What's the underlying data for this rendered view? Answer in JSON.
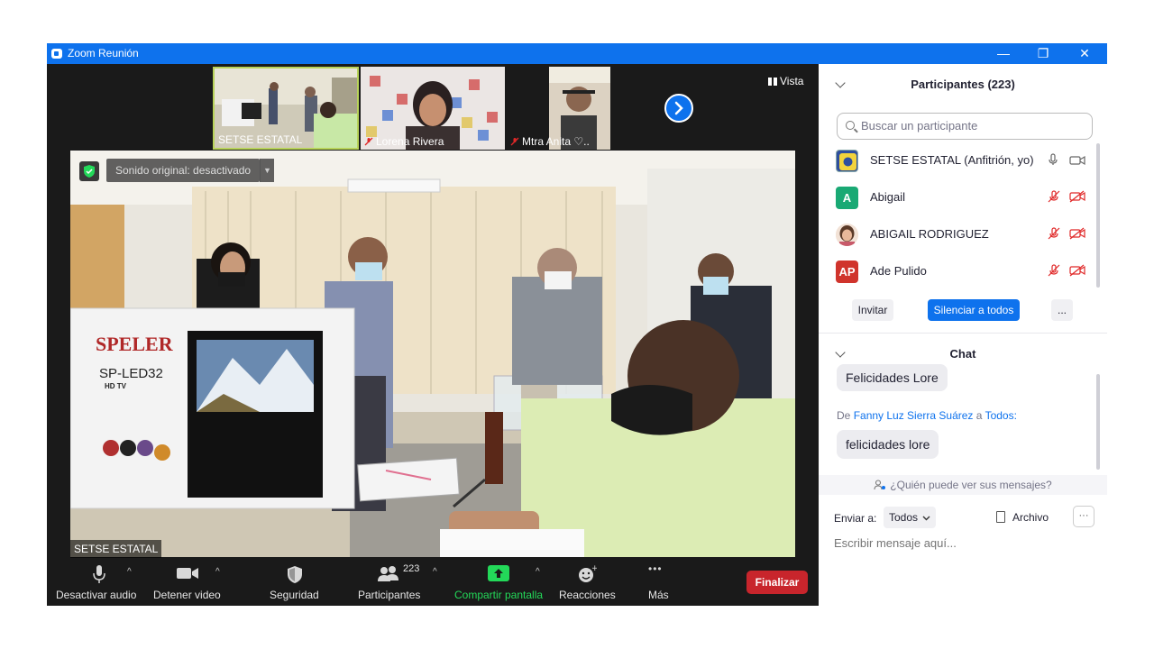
{
  "window": {
    "title": "Zoom Reunión",
    "minimize": "—",
    "restore": "❐",
    "close": "✕"
  },
  "thumbnails": [
    {
      "name": "SETSE ESTATAL",
      "muted": false
    },
    {
      "name": "Lorena Rivera",
      "muted": true
    },
    {
      "name": "Mtra Anita ♡..",
      "muted": true
    }
  ],
  "view": {
    "label": "Vista"
  },
  "main_video": {
    "sound_label": "Sonido original: desactivado",
    "speaker_name": "SETSE ESTATAL",
    "tv_brand": "SPELER",
    "tv_model": "SP-LED32",
    "tv_sub": "HD TV"
  },
  "toolbar": {
    "audio": "Desactivar audio",
    "video": "Detener video",
    "security": "Seguridad",
    "participants": "Participantes",
    "participant_count": "223",
    "share": "Compartir pantalla",
    "reactions": "Reacciones",
    "more": "Más",
    "more_dots": "•••",
    "end": "Finalizar"
  },
  "participants_panel": {
    "title": "Participantes (223)",
    "search_placeholder": "Buscar un participante",
    "list": [
      {
        "initials": "",
        "name": "SETSE ESTATAL (Anfitrión, yo)",
        "color": "#f2d33c",
        "muted": false
      },
      {
        "initials": "A",
        "name": "Abigail",
        "color": "#19a974",
        "muted": true
      },
      {
        "initials": "",
        "name": "ABIGAIL RODRIGUEZ",
        "color": "#e8b89a",
        "muted": true
      },
      {
        "initials": "AP",
        "name": "Ade Pulido",
        "color": "#d0342c",
        "muted": true
      }
    ],
    "invite": "Invitar",
    "mute_all": "Silenciar a todos",
    "more": "..."
  },
  "chat": {
    "title": "Chat",
    "messages": [
      {
        "text": "Felicidades Lore"
      },
      {
        "from_prefix": "De",
        "sender": "Fanny Luz Sierra Suárez",
        "to_word": "a",
        "recipient": "Todos:",
        "text": "felicidades lore"
      }
    ],
    "who_sees": "¿Quién puede ver sus mensajes?",
    "send_to_label": "Enviar a:",
    "send_to_value": "Todos",
    "file_label": "Archivo",
    "more": "···",
    "placeholder": "Escribir mensaje aquí..."
  },
  "colors": {
    "zoom_blue": "#0e72ed",
    "end_red": "#c8252c",
    "share_green": "#23d959",
    "muted_red": "#e02828"
  }
}
